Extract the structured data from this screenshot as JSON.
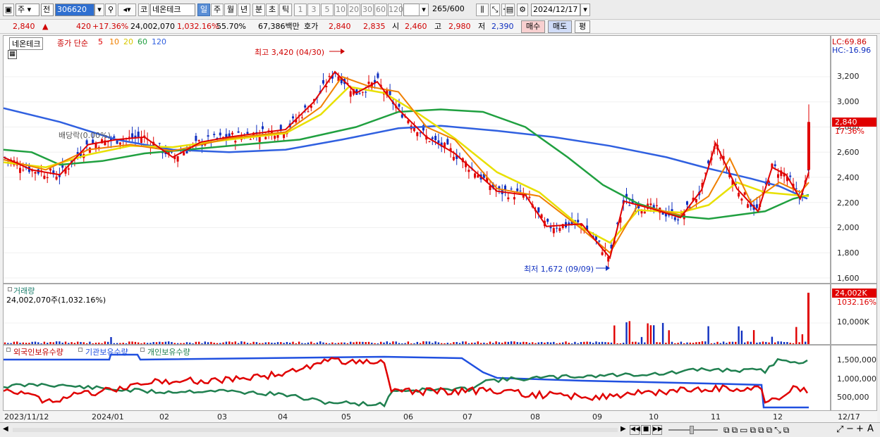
{
  "toolbar": {
    "market": "주",
    "prev_label": "전",
    "code": "306620",
    "stock_prefix": "코",
    "stock_name": "네온테크",
    "periods": [
      "일",
      "주",
      "월",
      "년",
      "분",
      "초",
      "틱"
    ],
    "selected_period": "일",
    "minute_options": [
      "1",
      "3",
      "5",
      "10",
      "20",
      "30",
      "60",
      "120"
    ],
    "count_display": "265",
    "count_total": "/600",
    "date": "2024/12/17"
  },
  "quote": {
    "price": "2,840",
    "change": "420",
    "change_pct": "+17.36%",
    "volume": "24,002,070",
    "volume_pct": "1,032.16%",
    "turnover_pct": "55.70%",
    "amount": "67,386백만",
    "ask_label": "호가",
    "ask1": "2,840",
    "ask2": "2,835",
    "open_label": "시",
    "open": "2,460",
    "high_label": "고",
    "high": "2,980",
    "low_label": "저",
    "low": "2,390",
    "buy_label": "매수",
    "sell_label": "매도",
    "avg_label": "평"
  },
  "price_pane": {
    "stock_tag": "네온테크",
    "ma_label": "종가 단순",
    "ma_periods": [
      "5",
      "10",
      "20",
      "60",
      "120"
    ],
    "ma_colors": [
      "#e00000",
      "#f08000",
      "#e8e000",
      "#20a040",
      "#3060e0"
    ],
    "lc": "LC:69.86",
    "hc": "HC:-16.96",
    "high_note": "최고 3,420 (04/30)",
    "low_note": "최저 1,672 (09/09)",
    "bae_note": "배당락(0.00%)",
    "current_price": "2,840",
    "current_pct": "17.36%",
    "y_ticks": [
      "3,200",
      "3,000",
      "2,800",
      "2,600",
      "2,400",
      "2,200",
      "2,000",
      "1,800",
      "1,600"
    ]
  },
  "volume_pane": {
    "title": "거래량",
    "value_text": "24,002,070주(1,032.16%)",
    "current": "24,002K",
    "current_pct": "1032.16%",
    "y_tick": "10,000K"
  },
  "holding_pane": {
    "legend": [
      "외국인보유수량",
      "기관보유수량",
      "개인보유수량"
    ],
    "legend_colors": [
      "#e00000",
      "#2050e0",
      "#208050"
    ],
    "y_ticks": [
      "1,500,000",
      "1,000,000",
      "500,000"
    ]
  },
  "x_axis": [
    "2023/11/12",
    "2024/01",
    "02",
    "03",
    "04",
    "05",
    "06",
    "07",
    "08",
    "09",
    "10",
    "11",
    "12"
  ],
  "x_axis_end": "12/17"
}
